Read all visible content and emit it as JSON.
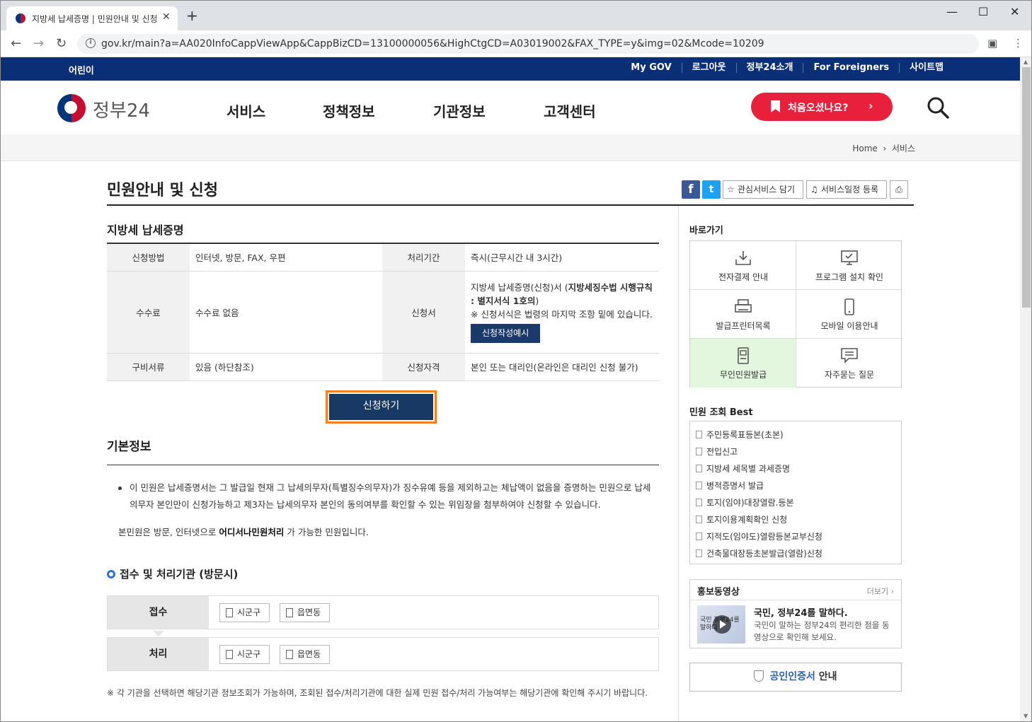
{
  "browser": {
    "tab_title": "지방세 납세증명 | 민원안내 및 신청",
    "url": "gov.kr/main?a=AA020InfoCappViewApp&CappBizCD=13100000056&HighCtgCD=A03019002&FAX_TYPE=y&img=02&Mcode=10209"
  },
  "top_strip": {
    "kids": "어린이",
    "links": [
      "My GOV",
      "로그아웃",
      "정부24소개",
      "For Foreigners",
      "사이트맵"
    ]
  },
  "header": {
    "logo": "정부24",
    "nav": [
      "서비스",
      "정책정보",
      "기관정보",
      "고객센터"
    ],
    "first_visit": "처음오셨나요?"
  },
  "breadcrumb": {
    "home": "Home",
    "current": "서비스"
  },
  "page": {
    "title": "민원안내 및 신청",
    "tools": {
      "favorite": "관심서비스 담기",
      "schedule": "서비스일정 등록"
    }
  },
  "service": {
    "name": "지방세 납세증명",
    "rows": {
      "method_label": "신청방법",
      "method": "인터넷, 방문, FAX, 우편",
      "period_label": "처리기간",
      "period": "즉시(근무시간 내 3시간)",
      "fee_label": "수수료",
      "fee": "수수료 없음",
      "form_label": "신청서",
      "form_text_a": "지방세 납세증명(신청)서 (",
      "form_text_b": "지방세징수법 시행규칙 : 별지서식 1호의",
      "form_text_c": ")",
      "form_note": "※ 신청서식은 법령의 마지막 조항 밑에 있습니다.",
      "form_button": "신청작성예시",
      "docs_label": "구비서류",
      "docs": "있음 (하단참조)",
      "qual_label": "신청자격",
      "qual": "본인 또는 대리인(온라인은 대리인 신청 불가)"
    },
    "apply_button": "신청하기"
  },
  "basic": {
    "title": "기본정보",
    "bullet": "이 민원은 납세증명서는 그 발급일 현재 그 납세의무자(특별징수의무자)가 징수유예 등을 제외하고는 체납액이 없음을 증명하는 민원으로 납세의무자 본인만이 신청가능하고 제3자는 납세의무자 본인의 동의여부를 확인할 수 있는 위임장을 첨부하여야 신청할 수 있습니다.",
    "note_a": "본민원은 방문, 인터넷으로 ",
    "note_b": "어디서나민원처리",
    "note_c": " 가 가능한 민원입니다."
  },
  "offices": {
    "title": "접수 및 처리기관 (방문시)",
    "receive_label": "접수",
    "process_label": "처리",
    "btn_sigungu": "시군구",
    "btn_eupmyeondong": "읍면동",
    "footnote": "※ 각 기관을 선택하면 해당기관 정보조회가 가능하며, 조회된 접수/처리기관에 대한 실제 민원 접수/처리 가능여부는 해당기관에 확인해 주시기 바랍니다."
  },
  "sidebar": {
    "quick_title": "바로가기",
    "quick": [
      "전자결제 안내",
      "프로그램 설치 확인",
      "발급프린터목록",
      "모바일 이용안내",
      "무인민원발급",
      "자주묻는 질문"
    ],
    "best_title": "민원 조회 Best",
    "best": [
      "주민등록표등본(초본)",
      "전입신고",
      "지방세 세목별 과세증명",
      "병적증명서 발급",
      "토지(임야)대장열람.등본",
      "토지이용계획확인 신청",
      "지적도(임야도)열람등본교부신청",
      "건축물대장등초본발급(열람)신청"
    ],
    "promo_title": "홍보동영상",
    "promo_more": "더보기",
    "promo_thumb": "국민 정부24를 말하다",
    "promo_head": "국민, 정부24를 말하다.",
    "promo_desc": "국민이 말하는 정부24의 편리한 점을 동영상으로 확인해 보세요.",
    "cert_a": "공인인증서",
    "cert_b": " 안내"
  },
  "colors": {
    "navy": "#0b2f77",
    "accent_red": "#e8203c",
    "apply_border": "#f08022",
    "highlight_green": "#e3f7df"
  }
}
